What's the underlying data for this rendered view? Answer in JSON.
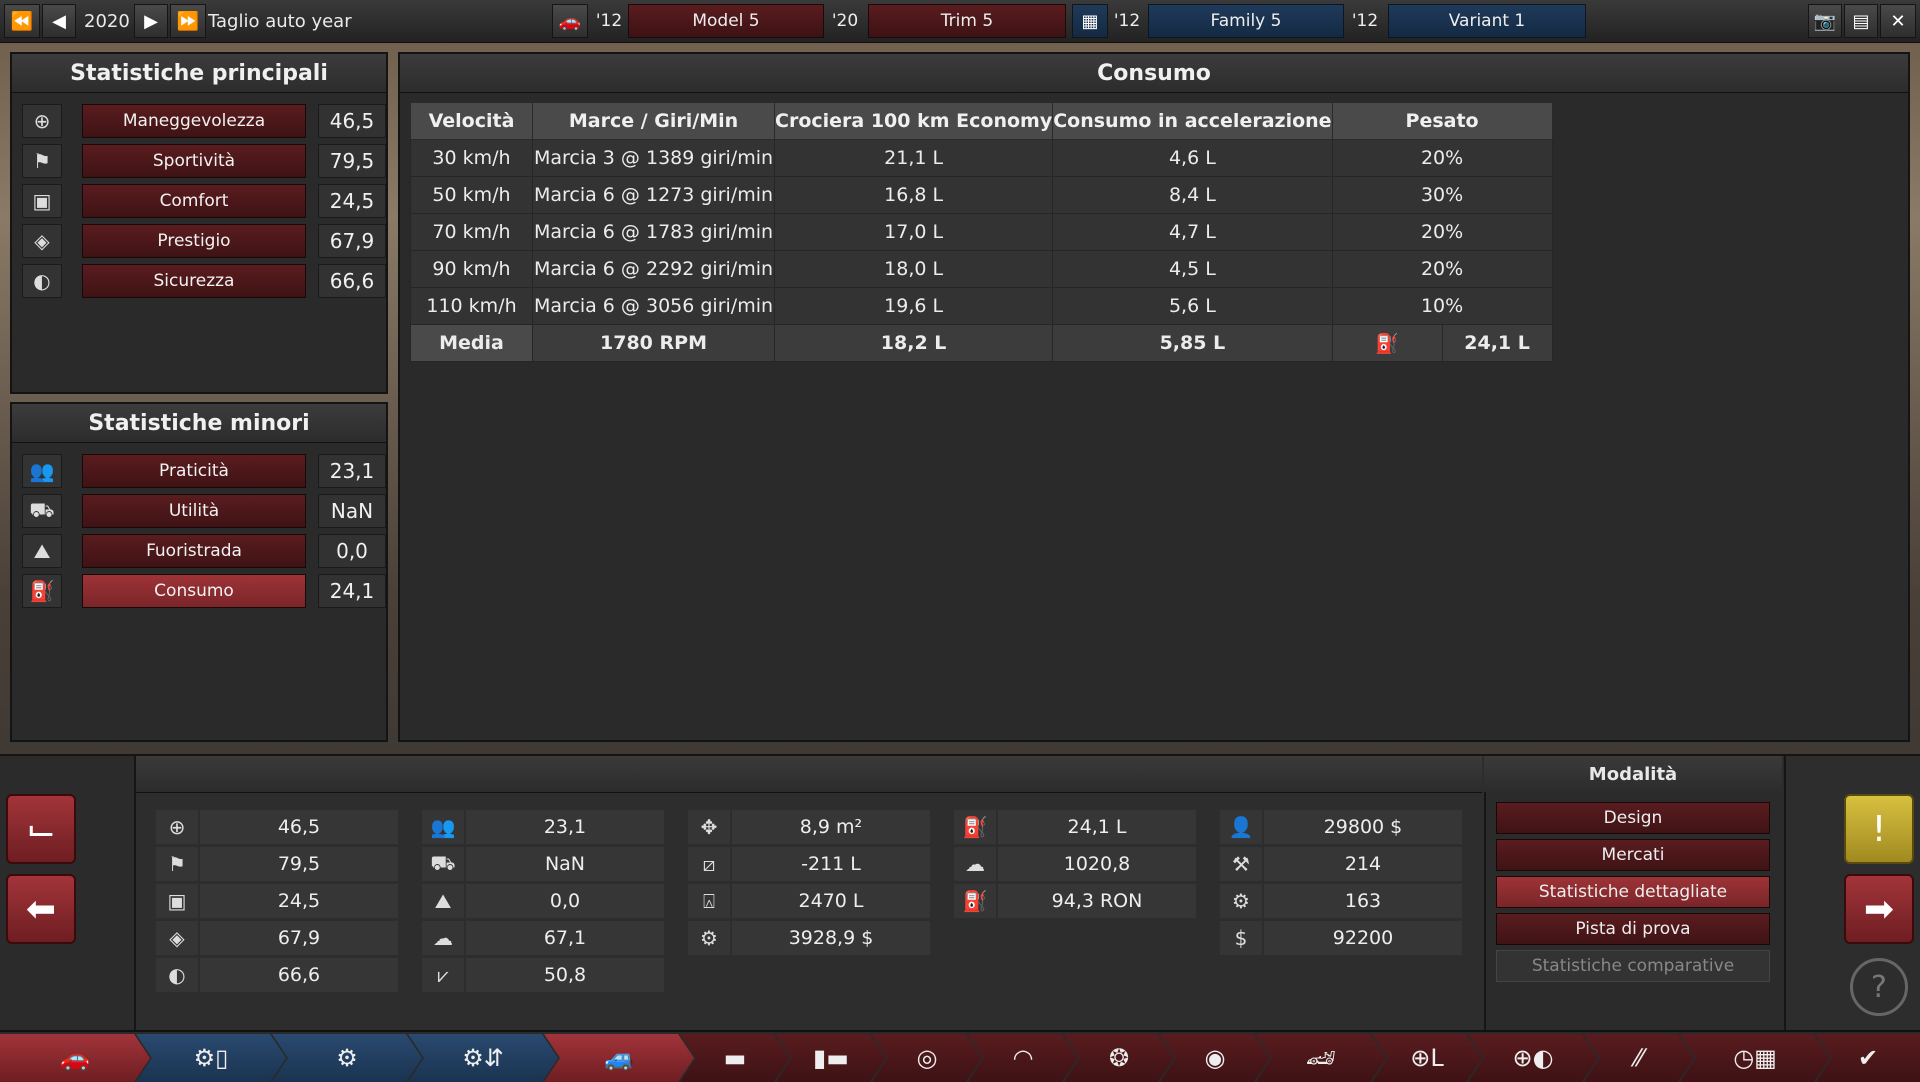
{
  "topbar": {
    "year": "2020",
    "taglio_label": "Taglio auto year",
    "model_year": "'12",
    "model_label": "Model 5",
    "trim_year": "'20",
    "trim_label": "Trim 5",
    "family_year": "'12",
    "family_label": "Family 5",
    "variant_year": "'12",
    "variant_label": "Variant 1"
  },
  "main_stats": {
    "title": "Statistiche principali",
    "items": [
      {
        "label": "Maneggevolezza",
        "value": "46,5",
        "icon": "steering-wheel-icon"
      },
      {
        "label": "Sportività",
        "value": "79,5",
        "icon": "checkered-flag-icon"
      },
      {
        "label": "Comfort",
        "value": "24,5",
        "icon": "seat-icon"
      },
      {
        "label": "Prestigio",
        "value": "67,9",
        "icon": "diamond-icon"
      },
      {
        "label": "Sicurezza",
        "value": "66,6",
        "icon": "crash-test-icon"
      }
    ]
  },
  "minor_stats": {
    "title": "Statistiche minori",
    "items": [
      {
        "label": "Praticità",
        "value": "23,1",
        "icon": "passengers-icon"
      },
      {
        "label": "Utilità",
        "value": "NaN",
        "icon": "truck-icon"
      },
      {
        "label": "Fuoristrada",
        "value": "0,0",
        "icon": "offroad-icon"
      },
      {
        "label": "Consumo",
        "value": "24,1",
        "icon": "fuel-can-icon"
      }
    ]
  },
  "consumo": {
    "title": "Consumo",
    "headers": [
      "Velocità",
      "Marce / Giri/Min",
      "Crociera 100 km Economy",
      "Consumo in accelerazione",
      "Pesato"
    ],
    "rows": [
      [
        "30 km/h",
        "Marcia 3 @ 1389 giri/min",
        "21,1 L",
        "4,6 L",
        "20%"
      ],
      [
        "50 km/h",
        "Marcia 6 @ 1273 giri/min",
        "16,8 L",
        "8,4 L",
        "30%"
      ],
      [
        "70 km/h",
        "Marcia 6 @ 1783 giri/min",
        "17,0 L",
        "4,7 L",
        "20%"
      ],
      [
        "90 km/h",
        "Marcia 6 @ 2292 giri/min",
        "18,0 L",
        "4,5 L",
        "20%"
      ],
      [
        "110 km/h",
        "Marcia 6 @ 3056 giri/min",
        "19,6 L",
        "5,6 L",
        "10%"
      ]
    ],
    "avg": {
      "label": "Media",
      "rpm": "1780 RPM",
      "cruise": "18,2 L",
      "accel": "5,85 L",
      "weighted": "24,1 L"
    }
  },
  "bottom": {
    "col1": [
      "46,5",
      "79,5",
      "24,5",
      "67,9",
      "66,6"
    ],
    "col2": [
      "23,1",
      "NaN",
      "0,0",
      "67,1",
      "50,8"
    ],
    "col3": [
      "8,9 m²",
      "-211 L",
      "2470 L",
      "3928,9 $"
    ],
    "col4": [
      "24,1 L",
      "1020,8",
      "94,3 RON"
    ],
    "col5": [
      "29800 $",
      "214",
      "163",
      "92200"
    ]
  },
  "modes": {
    "title": "Modalità",
    "items": [
      "Design",
      "Mercati",
      "Statistiche dettagliate",
      "Pista di prova",
      "Statistiche comparative"
    ]
  }
}
